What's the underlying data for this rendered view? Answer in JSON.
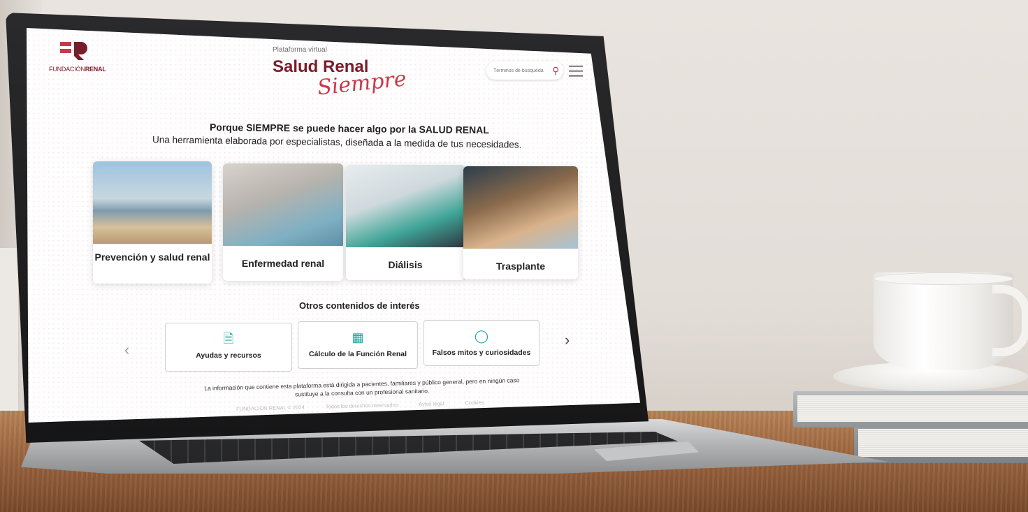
{
  "header": {
    "logo_text_light": "FUNDACIÓN",
    "logo_text_bold": "RENAL",
    "brand_small": "Plataforma virtual",
    "brand_main": "Salud Renal",
    "brand_script": "Siempre",
    "search_placeholder": "Términos de búsqueda"
  },
  "intro": {
    "headline": "Porque SIEMPRE se puede hacer algo por la SALUD RENAL",
    "subline": "Una herramienta elaborada por especialistas, diseñada a la medida de tus necesidades."
  },
  "cards": [
    {
      "label": "Prevención y salud renal"
    },
    {
      "label": "Enfermedad renal"
    },
    {
      "label": "Diálisis"
    },
    {
      "label": "Trasplante"
    }
  ],
  "other": {
    "title": "Otros contenidos de interés",
    "items": [
      {
        "label": "Ayudas y recursos",
        "icon": "document-icon"
      },
      {
        "label": "Cálculo de la Función Renal",
        "icon": "calculator-icon"
      },
      {
        "label": "Falsos mitos y curiosidades",
        "icon": "chat-bubble-icon"
      }
    ]
  },
  "disclaimer": "La información que contiene esta plataforma está dirigida a pacientes, familiares y público general, pero en ningún caso sustituye a la consulta con un profesional sanitario.",
  "footer": {
    "copyright": "FUNDACIÓN RENAL © 2024",
    "rights": "Todos los derechos reservados",
    "legal": "Aviso legal",
    "cookies": "Cookies"
  },
  "colors": {
    "brand": "#7a1d2a",
    "accent": "#c83a4a",
    "icon": "#1fa8a0"
  }
}
